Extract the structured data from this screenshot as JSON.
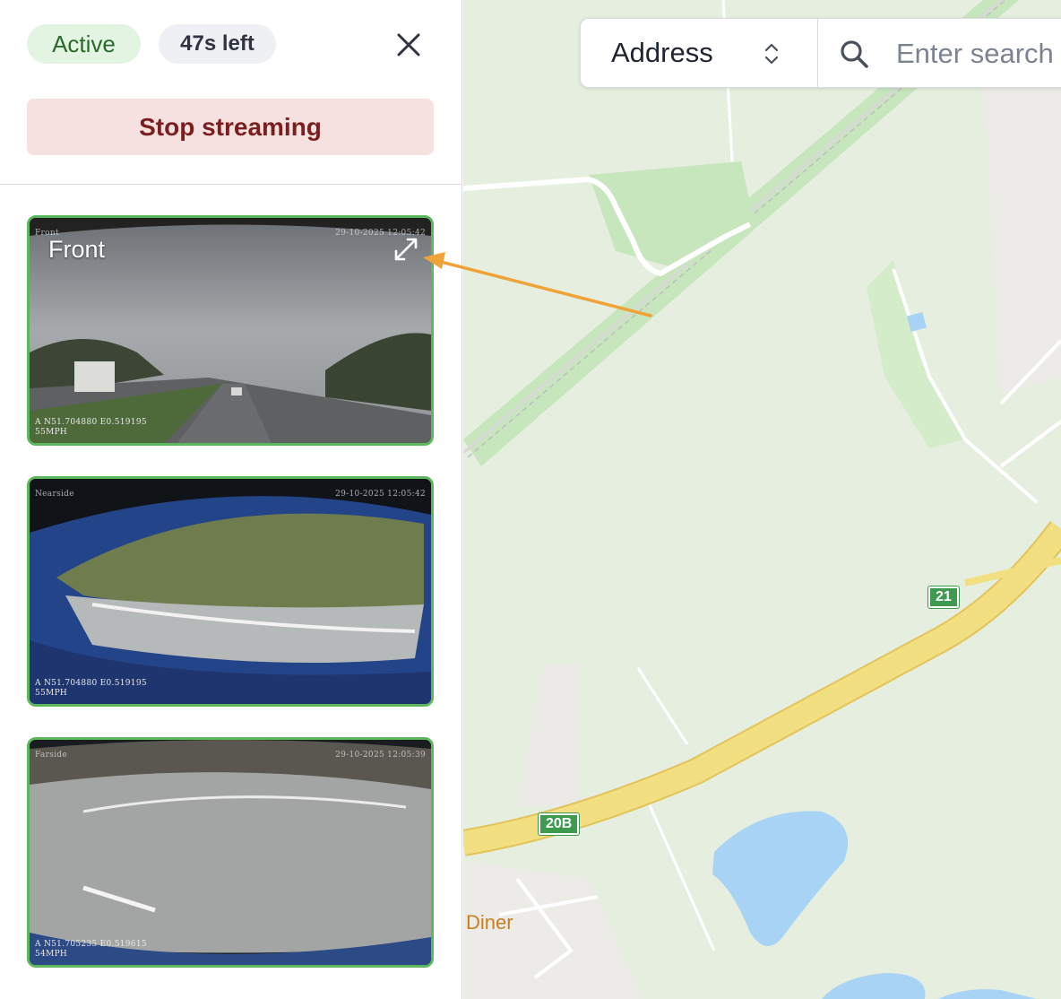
{
  "status": {
    "active_label": "Active",
    "time_left": "47s left"
  },
  "actions": {
    "stop_label": "Stop streaming"
  },
  "icons": {
    "close": "close-icon",
    "expand": "expand-icon",
    "search": "search-icon",
    "select": "chevron-updown-icon"
  },
  "cameras": [
    {
      "label": "Front",
      "osd_name": "Front",
      "timestamp": "29-10-2025 12:05:42",
      "gps": "A N51.704880 E0.519195",
      "speed": "55MPH"
    },
    {
      "osd_name": "Nearside",
      "timestamp": "29-10-2025 12:05:42",
      "gps": "A N51.704880 E0.519195",
      "speed": "55MPH"
    },
    {
      "osd_name": "Farside",
      "timestamp": "29-10-2025 12:05:39",
      "gps": "A N51.705235 E0.519615",
      "speed": "54MPH"
    }
  ],
  "map": {
    "search_type": "Address",
    "search_placeholder": "Enter search",
    "road_shields": [
      "21",
      "20B"
    ],
    "poi_label": "Diner"
  },
  "colors": {
    "accent_green": "#5cb85c",
    "stop_bg": "#f6e1e1",
    "stop_text": "#7a1f1f",
    "arrow": "#f0a23a",
    "motorway": "#f1df82",
    "water": "#a9d3f5"
  }
}
